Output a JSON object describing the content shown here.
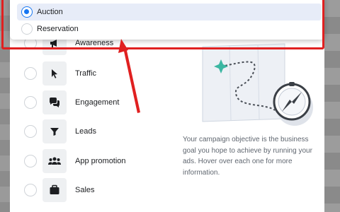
{
  "dropdown": {
    "options": [
      {
        "label": "Auction",
        "selected": true
      },
      {
        "label": "Reservation",
        "selected": false
      }
    ]
  },
  "objectives": [
    {
      "label": "Awareness",
      "icon": "megaphone-icon"
    },
    {
      "label": "Traffic",
      "icon": "cursor-icon"
    },
    {
      "label": "Engagement",
      "icon": "chat-icon"
    },
    {
      "label": "Leads",
      "icon": "filter-icon"
    },
    {
      "label": "App promotion",
      "icon": "people-icon"
    },
    {
      "label": "Sales",
      "icon": "briefcase-icon"
    }
  ],
  "description": "Your campaign objective is the business goal you hope to achieve by running your ads. Hover over each one for more information.",
  "colors": {
    "accent": "#1877f2",
    "annotation": "#e02020",
    "illustration_teal": "#3bb7a2"
  }
}
